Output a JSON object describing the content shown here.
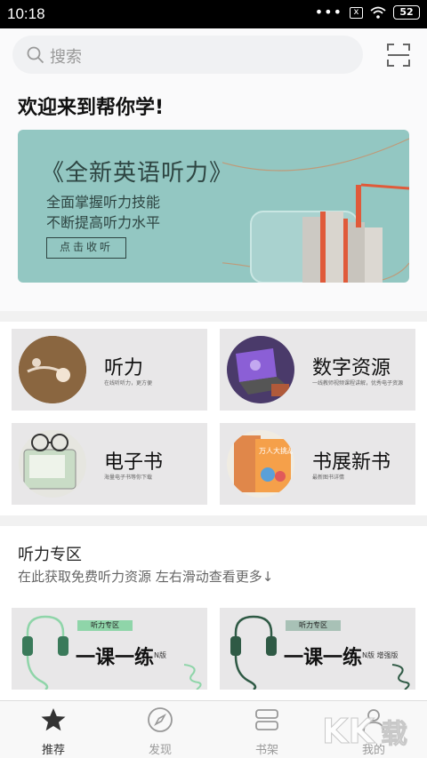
{
  "status": {
    "time": "10:18",
    "battery": "52",
    "sim_icon": "x"
  },
  "search": {
    "placeholder": "搜索"
  },
  "welcome": "欢迎来到帮你学!",
  "banner": {
    "title": "《全新英语听力》",
    "line1": "全面掌握听力技能",
    "line2": "不断提高听力水平",
    "button": "点击收听"
  },
  "categories": [
    {
      "name": "听力",
      "desc": "在线听听力，更方便"
    },
    {
      "name": "数字资源",
      "desc": "一线教师视频课程讲解，优秀电子资源"
    },
    {
      "name": "电子书",
      "desc": "海量电子书等你下载"
    },
    {
      "name": "书展新书",
      "desc": "最新图书详情"
    }
  ],
  "book_cover_text": "万人大挑战",
  "listening": {
    "heading": "听力专区",
    "subheading": "在此获取免费听力资源   左右滑动查看更多↓",
    "cards": [
      {
        "tag": "听力专区",
        "title": "一课一练",
        "version": "N版"
      },
      {
        "tag": "听力专区",
        "title": "一课一练",
        "version": "N版 增强版"
      }
    ]
  },
  "tabs": [
    {
      "label": "推荐",
      "icon": "star-icon",
      "active": true
    },
    {
      "label": "发现",
      "icon": "compass-icon",
      "active": false
    },
    {
      "label": "书架",
      "icon": "bookshelf-icon",
      "active": false
    },
    {
      "label": "我的",
      "icon": "person-icon",
      "active": false
    }
  ],
  "watermark": "KK下载",
  "colors": {
    "banner_bg": "#93c7c2",
    "card_bg": "#e8e7e8",
    "tag_green": "#8fd5a9",
    "tag_gray": "#a8c1b6"
  }
}
